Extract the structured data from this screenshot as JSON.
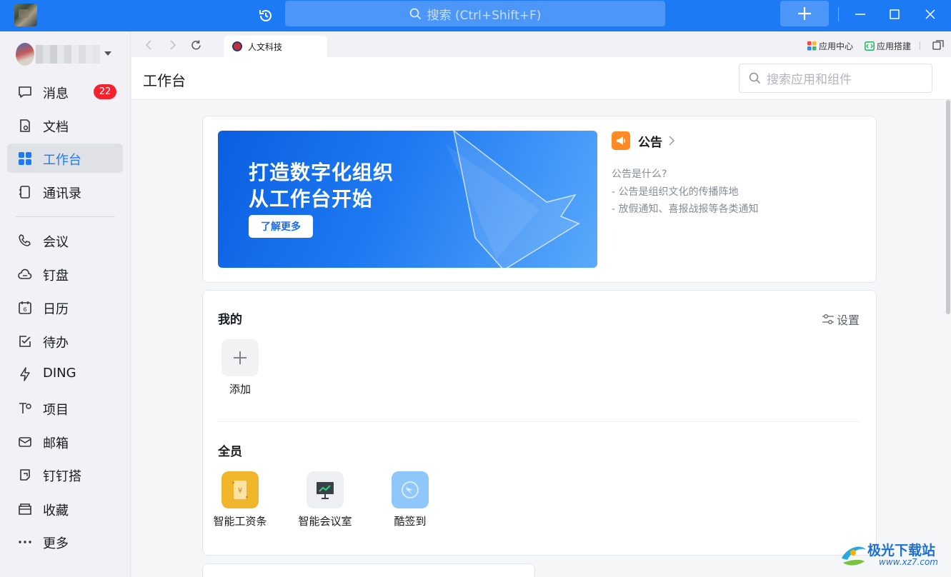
{
  "titlebar": {
    "search_placeholder": "搜索 (Ctrl+Shift+F)",
    "accent": "#1d7af5"
  },
  "sidebar": {
    "items": [
      {
        "label": "消息",
        "icon": "message-icon",
        "badge": "22"
      },
      {
        "label": "文档",
        "icon": "document-icon"
      },
      {
        "label": "工作台",
        "icon": "workbench-icon",
        "active": true
      },
      {
        "label": "通讯录",
        "icon": "contacts-icon"
      },
      {
        "label": "会议",
        "icon": "phone-icon"
      },
      {
        "label": "钉盘",
        "icon": "cloud-icon"
      },
      {
        "label": "日历",
        "icon": "calendar-icon",
        "icon_text": "6"
      },
      {
        "label": "待办",
        "icon": "todo-icon"
      },
      {
        "label": "DING",
        "icon": "lightning-icon"
      },
      {
        "label": "项目",
        "icon": "project-icon"
      },
      {
        "label": "邮箱",
        "icon": "mail-icon"
      },
      {
        "label": "钉钉搭",
        "icon": "builder-icon"
      },
      {
        "label": "收藏",
        "icon": "favorites-icon"
      },
      {
        "label": "更多",
        "icon": "more-icon"
      }
    ]
  },
  "tabstrip": {
    "tab_label": "人文科技",
    "links": {
      "app_center": "应用中心",
      "app_builder": "应用搭建"
    }
  },
  "main": {
    "title": "工作台",
    "search_placeholder": "搜索应用和组件",
    "banner": {
      "line1": "打造数字化组织",
      "line2": "从工作台开始",
      "button": "了解更多"
    },
    "notice": {
      "title": "公告",
      "lines": [
        "公告是什么?",
        "- 公告是组织文化的传播阵地",
        "- 放假通知、喜报战报等各类通知"
      ]
    },
    "mine": {
      "title": "我的",
      "settings": "设置",
      "add_label": "添加"
    },
    "all_staff": {
      "title": "全员",
      "apps": [
        {
          "label": "智能工资条",
          "icon": "payslip-icon",
          "color": "#f0b52a"
        },
        {
          "label": "智能会议室",
          "icon": "meeting-room-icon",
          "color": "#eeeff2"
        },
        {
          "label": "酷签到",
          "icon": "check-in-icon",
          "color": "#8fc7fb"
        }
      ]
    }
  },
  "watermark": {
    "text": "极光下载站",
    "url": "www.xz7.com"
  }
}
